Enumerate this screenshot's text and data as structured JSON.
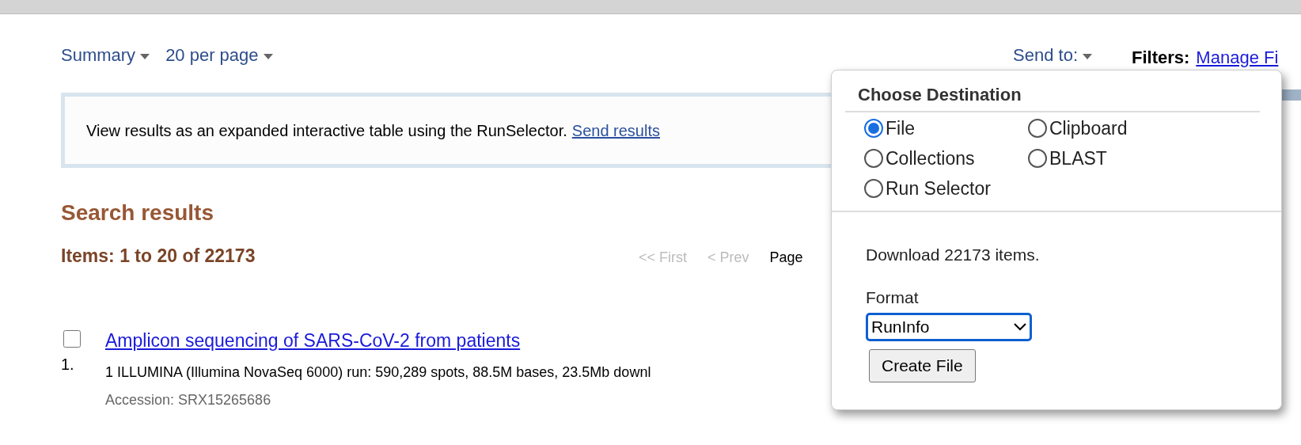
{
  "toolbar": {
    "format_menu": "Summary",
    "per_page_menu": "20 per page",
    "send_to": "Send to:",
    "filters_label": "Filters:",
    "filters_link": "Manage Fi"
  },
  "info_box": {
    "text": "View results as an expanded interactive table using the RunSelector.",
    "link": "Send results"
  },
  "results": {
    "title": "Search results",
    "count": "Items: 1 to 20 of 22173",
    "pager": [
      {
        "label": "<< First",
        "disabled": true
      },
      {
        "label": "< Prev",
        "disabled": true
      },
      {
        "label": "Page",
        "disabled": false
      }
    ],
    "items": [
      {
        "number": "1.",
        "checked": false,
        "title": "Amplicon sequencing of SARS-CoV-2 from patients",
        "description": "1 ILLUMINA (Illumina NovaSeq 6000) run: 590,289 spots, 88.5M bases, 23.5Mb downl",
        "accession": "Accession: SRX15265686"
      }
    ]
  },
  "send_to_popup": {
    "title": "Choose Destination",
    "destinations": [
      {
        "label": "File",
        "selected": true
      },
      {
        "label": "Clipboard",
        "selected": false
      },
      {
        "label": "Collections",
        "selected": false
      },
      {
        "label": "BLAST",
        "selected": false
      },
      {
        "label": "Run Selector",
        "selected": false
      }
    ],
    "download_text": "Download 22173 items.",
    "format_label": "Format",
    "format_value": "RunInfo",
    "create_button": "Create File"
  }
}
